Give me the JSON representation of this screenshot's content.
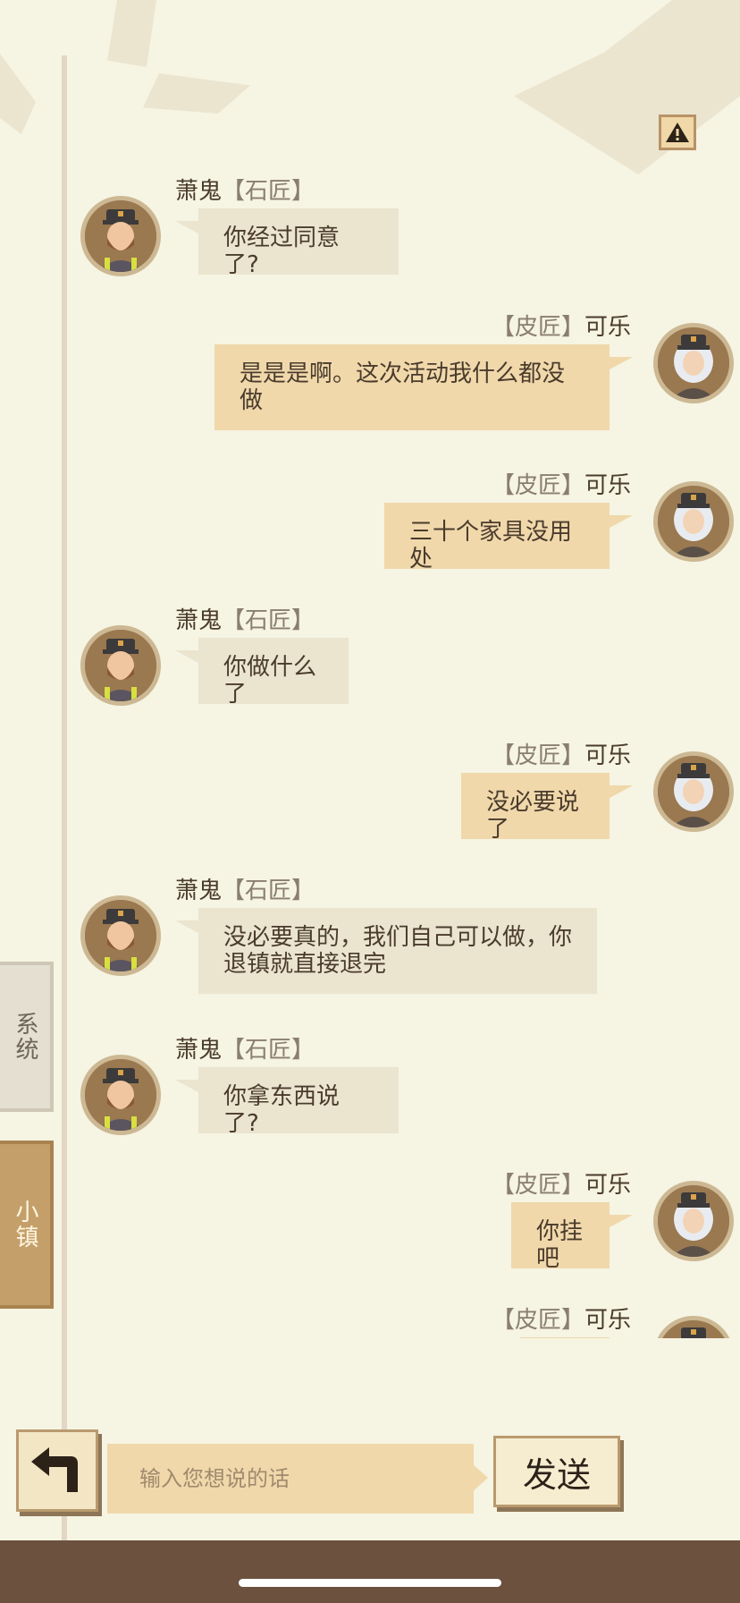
{
  "alert_icon": "warning-triangle-icon",
  "messages": [
    {
      "side": "left",
      "name": "萧鬼",
      "role": "【石匠】",
      "text": "你经过同意了?",
      "avatar": "bearded-man-avatar"
    },
    {
      "side": "right",
      "name": "可乐",
      "role": "【皮匠】",
      "text": "是是是啊。这次活动我什么都没做",
      "avatar": "white-haired-woman-avatar"
    },
    {
      "side": "right",
      "name": "可乐",
      "role": "【皮匠】",
      "text": "三十个家具没用处",
      "avatar": "white-haired-woman-avatar"
    },
    {
      "side": "left",
      "name": "萧鬼",
      "role": "【石匠】",
      "text": "你做什么了",
      "avatar": "bearded-man-avatar"
    },
    {
      "side": "right",
      "name": "可乐",
      "role": "【皮匠】",
      "text": "没必要说了",
      "avatar": "white-haired-woman-avatar"
    },
    {
      "side": "left",
      "name": "萧鬼",
      "role": "【石匠】",
      "text": "没必要真的，我们自己可以做，你退镇就直接退完",
      "avatar": "bearded-man-avatar"
    },
    {
      "side": "left",
      "name": "萧鬼",
      "role": "【石匠】",
      "text": "你拿东西说了?",
      "avatar": "bearded-man-avatar"
    },
    {
      "side": "right",
      "name": "可乐",
      "role": "【皮匠】",
      "text": "你挂吧",
      "avatar": "white-haired-woman-avatar"
    },
    {
      "side": "right",
      "name": "可乐",
      "role": "【皮匠】",
      "text": "",
      "avatar": "white-haired-woman-avatar"
    }
  ],
  "tabs": {
    "system": "系统",
    "town": "小镇"
  },
  "input": {
    "placeholder": "输入您想说的话",
    "value": ""
  },
  "send_label": "发送",
  "back_icon": "back-arrow-icon",
  "colors": {
    "background": "#f6f4e3",
    "bubble_self": "#f0d8ab",
    "bubble_other": "#ebe4cf",
    "bottom_bar": "#6c513f"
  }
}
